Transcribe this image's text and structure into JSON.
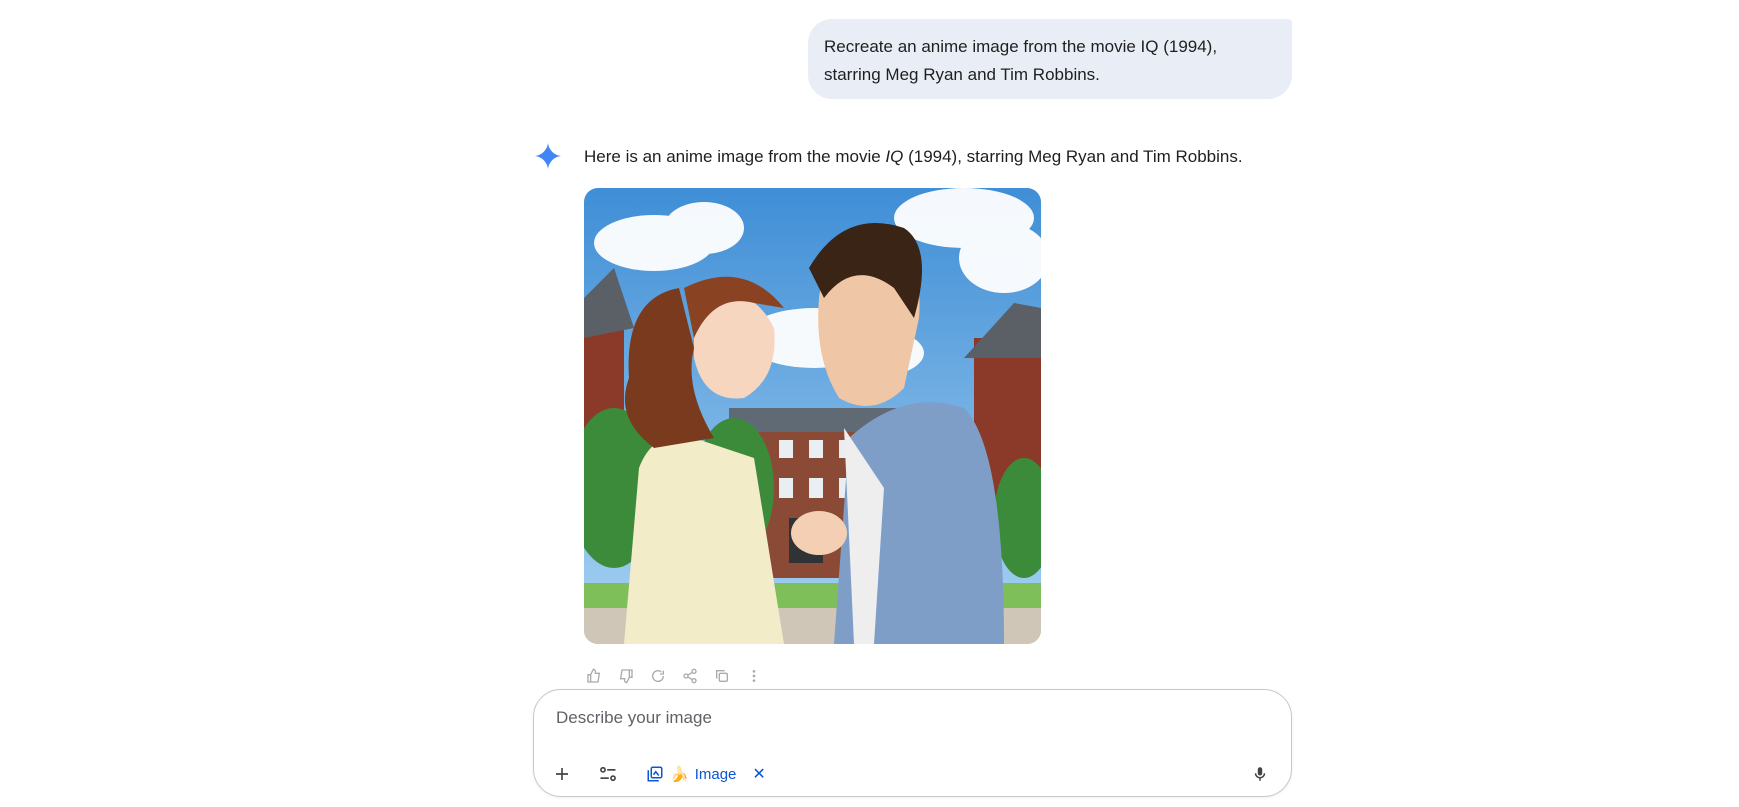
{
  "conversation": {
    "user_message": "Recreate an anime image from the movie IQ (1994), starring Meg Ryan and Tim Robbins.",
    "reply": {
      "prefix": "Here is an anime image from the movie ",
      "italic": "IQ",
      "suffix": " (1994), starring Meg Ryan and Tim Robbins."
    }
  },
  "actions": {
    "icons": [
      "thumb-up-icon",
      "thumb-down-icon",
      "regenerate-icon",
      "share-icon",
      "copy-icon",
      "more-options-icon"
    ]
  },
  "composer": {
    "placeholder": "Describe your image",
    "chip_label": "Image",
    "chip_emoji": "🍌",
    "close_glyph": "✕"
  },
  "colors": {
    "accent": "#0b57d0",
    "bubble": "#e9eef6",
    "spark": "#4285f4"
  }
}
